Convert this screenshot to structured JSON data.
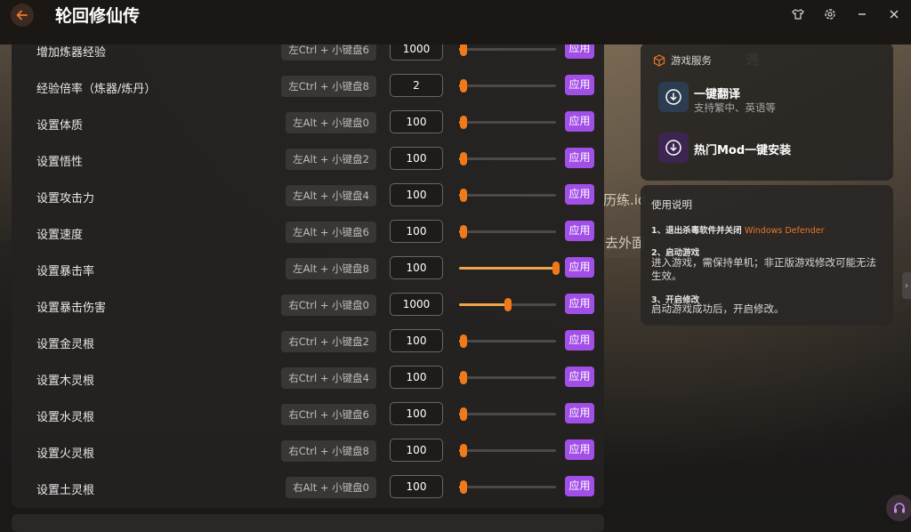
{
  "app": {
    "title": "轮回修仙传"
  },
  "rows": [
    {
      "label": "增加炼器经验",
      "hotkey": "左Ctrl + 小键盘6",
      "value": "1000",
      "level": 0.05,
      "apply": "应用"
    },
    {
      "label": "经验倍率（炼器/炼丹）",
      "hotkey": "左Ctrl + 小键盘8",
      "value": "2",
      "level": 0.05,
      "apply": "应用"
    },
    {
      "label": "设置体质",
      "hotkey": "左Alt + 小键盘0",
      "value": "100",
      "level": 0.05,
      "apply": "应用"
    },
    {
      "label": "设置悟性",
      "hotkey": "左Alt + 小键盘2",
      "value": "100",
      "level": 0.05,
      "apply": "应用"
    },
    {
      "label": "设置攻击力",
      "hotkey": "左Alt + 小键盘4",
      "value": "100",
      "level": 0.05,
      "apply": "应用"
    },
    {
      "label": "设置速度",
      "hotkey": "左Alt + 小键盘6",
      "value": "100",
      "level": 0.05,
      "apply": "应用"
    },
    {
      "label": "设置暴击率",
      "hotkey": "左Alt + 小键盘8",
      "value": "100",
      "level": 1.0,
      "apply": "应用"
    },
    {
      "label": "设置暴击伤害",
      "hotkey": "右Ctrl + 小键盘0",
      "value": "1000",
      "level": 0.5,
      "apply": "应用"
    },
    {
      "label": "设置金灵根",
      "hotkey": "右Ctrl + 小键盘2",
      "value": "100",
      "level": 0.05,
      "apply": "应用"
    },
    {
      "label": "设置木灵根",
      "hotkey": "右Ctrl + 小键盘4",
      "value": "100",
      "level": 0.05,
      "apply": "应用"
    },
    {
      "label": "设置水灵根",
      "hotkey": "右Ctrl + 小键盘6",
      "value": "100",
      "level": 0.05,
      "apply": "应用"
    },
    {
      "label": "设置火灵根",
      "hotkey": "右Ctrl + 小键盘8",
      "value": "100",
      "level": 0.05,
      "apply": "应用"
    },
    {
      "label": "设置土灵根",
      "hotkey": "右Alt + 小键盘0",
      "value": "100",
      "level": 0.05,
      "apply": "应用"
    }
  ],
  "services": {
    "header": "游戏服务",
    "items": [
      {
        "title": "一键翻译",
        "subtitle": "支持繁中、英语等"
      },
      {
        "title": "热门Mod一键安装",
        "subtitle": ""
      }
    ]
  },
  "guide": {
    "title": "使用说明",
    "step1": "1、退出杀毒软件并关闭",
    "step1_highlight": "Windows Defender",
    "step2": "2、启动游戏",
    "step2_desc": "进入游戏，需保持单机；非正版游戏修改可能无法生效。",
    "step3": "3、开启修改",
    "step3_desc": "启动游戏成功后，开启修改。"
  },
  "background": {
    "text_a": "历练.id",
    "text_b": "去外面",
    "text_c": "遇"
  },
  "colors": {
    "accent": "#a24fe8",
    "slider": "#f07a1a",
    "highlight": "#e8772a"
  },
  "icons": {
    "back": "arrow-left-icon",
    "shirt": "tshirt-icon",
    "settings": "gear-icon",
    "minimize": "minimize-icon",
    "close": "close-icon",
    "service": "cube-icon",
    "download": "download-icon",
    "headset": "headset-icon"
  }
}
